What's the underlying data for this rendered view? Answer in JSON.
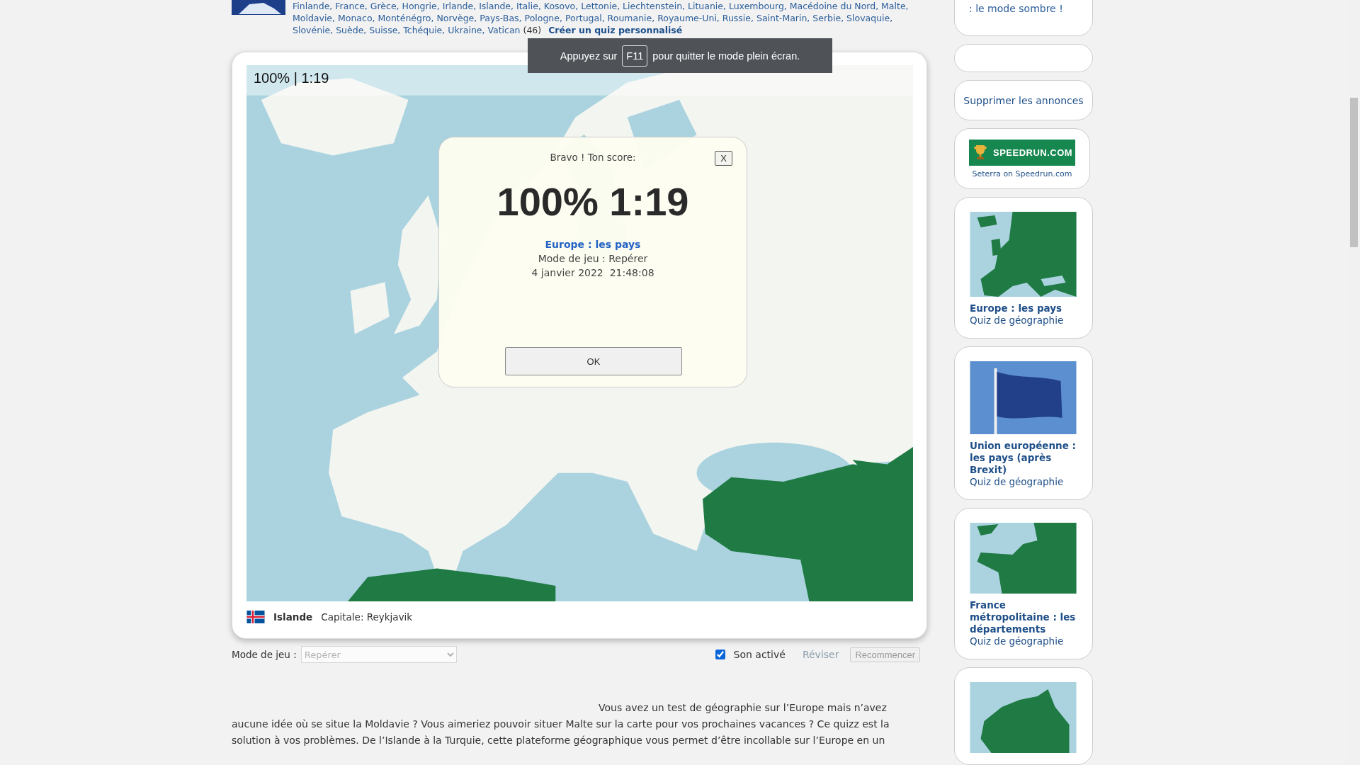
{
  "header": {
    "country_list_start": "Finlande, France, Grèce, Hongrie, Irlande, Islande, Italie, Kosovo, Lettonie, Liechtenstein, Lituanie, Luxembourg, Macédoine du Nord, Malte, Moldavie, Monaco, Monténégro, Norvège, Pays-Bas, Pologne, Portugal, Roumanie, Royaume-Uni, Russie, Saint-Marin, Serbie, Slovaquie, Slovénie, Suède, Suisse, Tchéquie, Ukraine, Vatican",
    "count": "(46)",
    "custom_quiz_link": "Créer un quiz personnalisé"
  },
  "fullscreen_notice": {
    "before": "Appuyez sur",
    "key": "F11",
    "after": "pour quitter le mode plein écran."
  },
  "map": {
    "status": "100% | 1:19"
  },
  "result_dialog": {
    "heading": "Bravo ! Ton score:",
    "close": "X",
    "score": "100% 1:19",
    "quiz_title": "Europe : les pays",
    "mode": "Mode de jeu : Repérer",
    "date": "4 janvier 2022  21:48:08",
    "ok": "OK"
  },
  "selected_country": {
    "name": "Islande",
    "capital": "Capitale: Reykjavik"
  },
  "controls": {
    "mode_label": "Mode de jeu :",
    "mode_value": "Repérer",
    "sound": {
      "label": "Son activé",
      "checked": true
    },
    "revise": {
      "label": "Réviser",
      "disabled": true
    },
    "restart": {
      "label": "Recommencer",
      "disabled": true
    }
  },
  "description": "Vous avez un test de géographie sur l’Europe mais n’avez aucune idée où se situe la Moldavie ? Vous aimeriez pouvoir situer Malte sur la carte pour vos prochaines vacances ? Ce quizz est la solution à vos problèmes. De l’Islande à la Turquie, cette plateforme géographique vous permet d’être incollable sur l’Europe en un",
  "sidebar": {
    "notice": ": le mode sombre !",
    "remove_ads": "Supprimer les annonces",
    "speedrun": {
      "logo": "SPEEDRUN.COM",
      "caption": "Seterra on Speedrun.com"
    },
    "quizzes": [
      {
        "kind": "europe-map",
        "title": "Europe : les pays",
        "subtitle": "Quiz de géographie"
      },
      {
        "kind": "flag-photo",
        "title": "Union européenne : les pays (après Brexit)",
        "subtitle": "Quiz de géographie"
      },
      {
        "kind": "france-map",
        "title": "France métropolitaine : les départements",
        "subtitle": "Quiz de géographie"
      },
      {
        "kind": "australia-map"
      }
    ]
  }
}
